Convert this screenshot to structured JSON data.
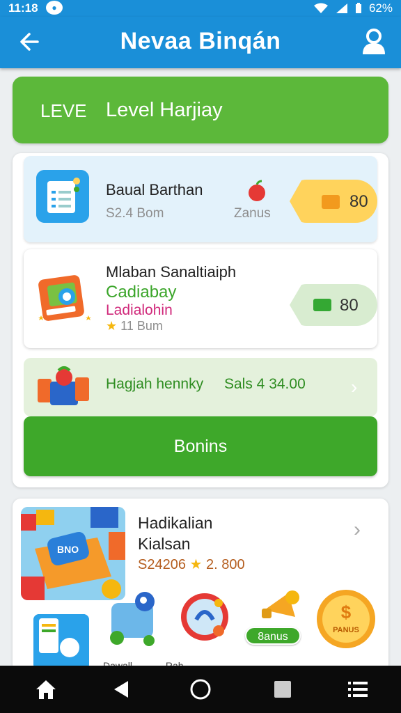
{
  "status_bar": {
    "time": "11:18",
    "battery_text": "62%"
  },
  "app_bar": {
    "title": "Nevaa Binqán"
  },
  "level_banner": {
    "tag": "LEVE",
    "label": "Level Harjiay"
  },
  "tasks": [
    {
      "title": "Baual Barthan",
      "subtitle": "S2.4 Bom",
      "bonus_label": "Zanus",
      "reward_value": "80"
    },
    {
      "title": "Mlaban Sanaltiaiph",
      "line1": "Cadiabay",
      "line2": "Ladialohin",
      "line3": "11 Bum",
      "reward_value": "80"
    },
    {
      "title": "Hagjah hennky",
      "amount": "Sals 4 34.00"
    }
  ],
  "bonus_button": {
    "label": "Bonins"
  },
  "promo_card": {
    "title_line1": "Hadikalian",
    "title_line2": "Kialsan",
    "price": "S24206",
    "rating": "2. 800",
    "pill_label": "8anus",
    "coin_label": "PANUS",
    "img_label": "BNO",
    "cut_text_1": "Dawall",
    "cut_text_2": "Rah"
  },
  "colors": {
    "primary": "#1a8fd8",
    "accent_green": "#3ea82a",
    "level_green": "#5cb83a",
    "reward_yellow": "#ffd35c",
    "subtitle_pink": "#d0287a"
  },
  "icons": [
    "back-arrow-icon",
    "profile-icon",
    "document-icon",
    "apple-icon",
    "wallet-icon",
    "cash-icon",
    "briefcase-icon",
    "gift-box-icon",
    "chevron-right-icon",
    "robot-icon",
    "lock-icon",
    "horn-icon",
    "coin-icon",
    "home-icon",
    "back-triangle-icon",
    "circle-home-icon",
    "square-recents-icon",
    "menu-icon"
  ]
}
